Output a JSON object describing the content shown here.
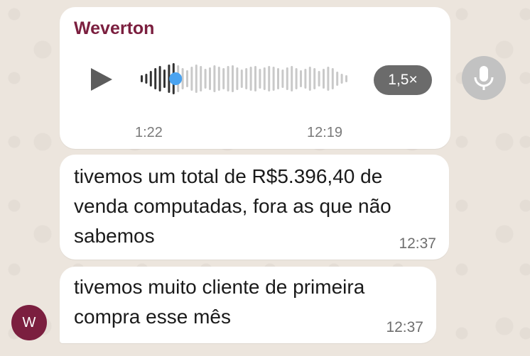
{
  "chat": {
    "sender_name": "Weverton",
    "avatar_initial": "W",
    "accent_color": "#7b1f3f"
  },
  "voice_message": {
    "duration": "1:22",
    "time": "12:19",
    "playback_speed": "1,5×",
    "progress": 0.18,
    "play_icon": "play-icon"
  },
  "messages": [
    {
      "text": "tivemos um total de R$5.396,40 de venda computadas, fora as que não sabemos",
      "time": "12:37"
    },
    {
      "text": "tivemos muito cliente de primeira compra esse mês",
      "time": "12:37"
    }
  ],
  "composer": {
    "mic_icon": "microphone-icon"
  }
}
